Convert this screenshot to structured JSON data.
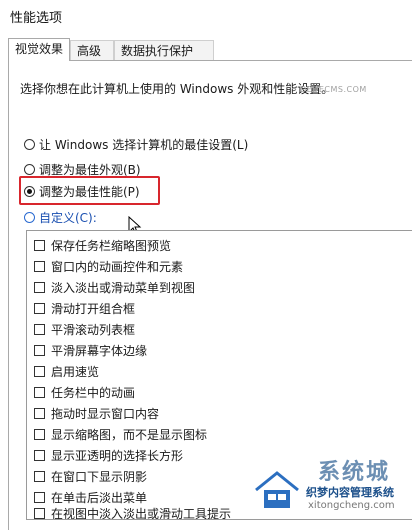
{
  "window": {
    "title": "性能选项"
  },
  "tabs": [
    {
      "label": "视觉效果"
    },
    {
      "label": "高级"
    },
    {
      "label": "数据执行保护"
    }
  ],
  "description": "选择你想在此计算机上使用的 Windows 外观和性能设置。",
  "options": [
    {
      "label": "让 Windows 选择计算机的最佳设置(L)"
    },
    {
      "label": "调整为最佳外观(B)"
    },
    {
      "label": "调整为最佳性能(P)"
    },
    {
      "label": "自定义(C):"
    }
  ],
  "selected_option": "调整为最佳性能(P)",
  "effects": [
    "保存任务栏缩略图预览",
    "窗口内的动画控件和元素",
    "淡入淡出或滑动菜单到视图",
    "滑动打开组合框",
    "平滑滚动列表框",
    "平滑屏幕字体边缘",
    "启用速览",
    "任务栏中的动画",
    "拖动时显示窗口内容",
    "显示缩略图，而不是显示图标",
    "显示亚透明的选择长方形",
    "在窗口下显示阴影",
    "在单击后淡出菜单",
    "在视图中淡入淡出或滑动工具提示"
  ],
  "watermark": {
    "big": "系统城",
    "sub": "织梦内容管理系统",
    "url": "xitongcheng.com",
    "domain": "DEDECMS.COM"
  },
  "colors": {
    "highlight": "#d8262d",
    "link_blue": "#1a4fb0"
  }
}
